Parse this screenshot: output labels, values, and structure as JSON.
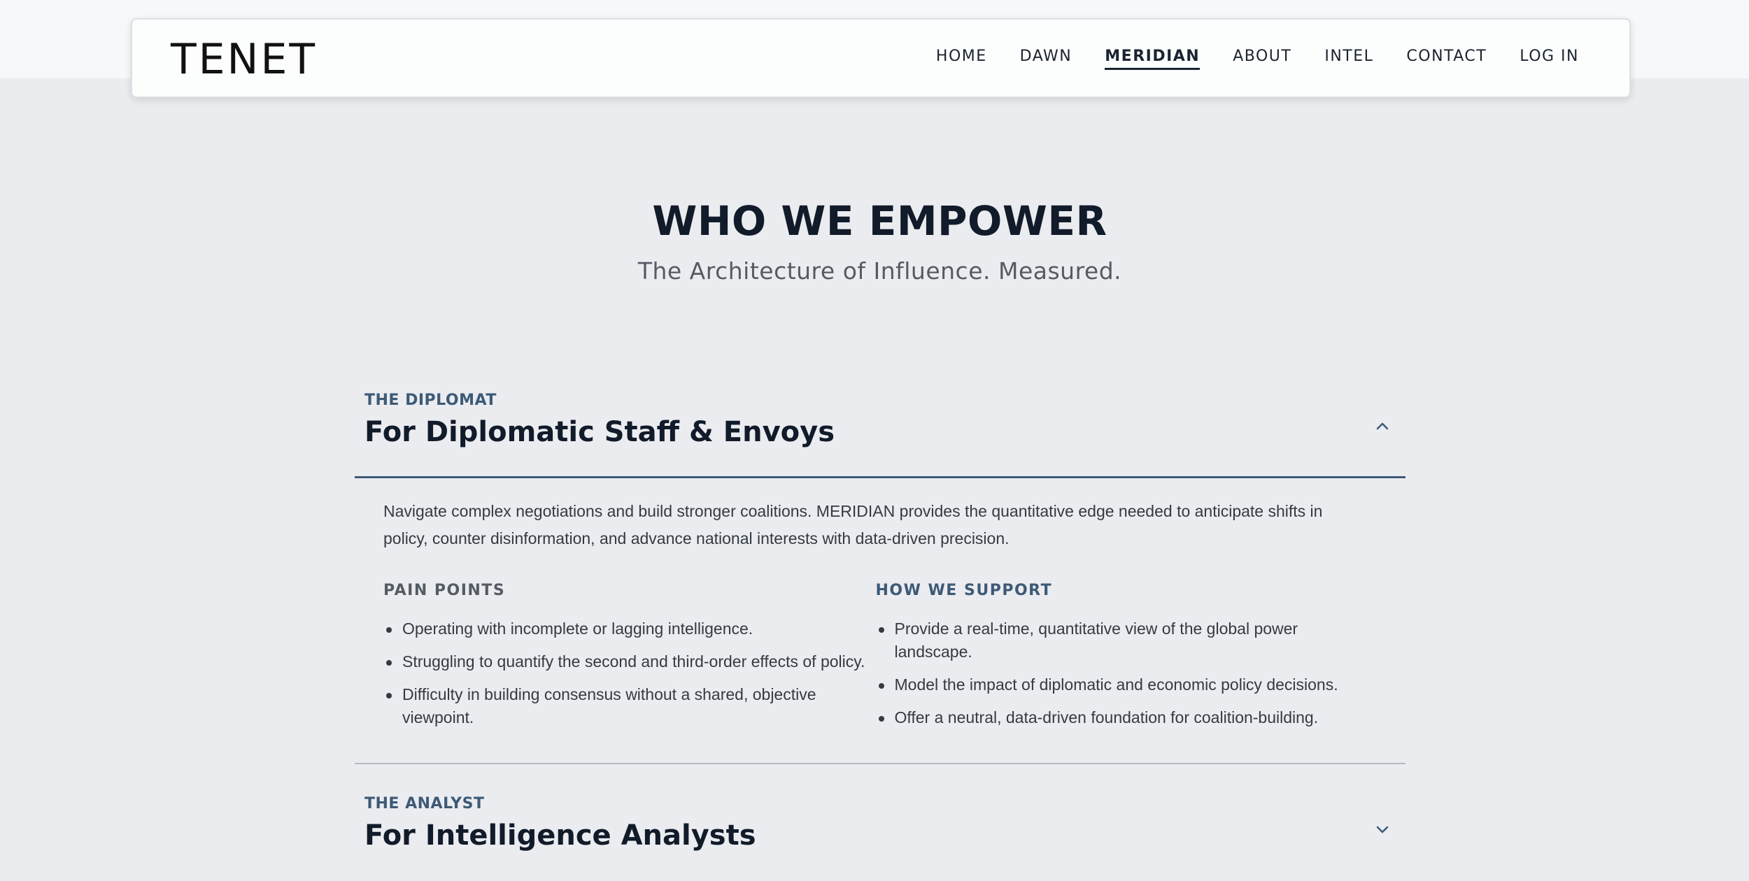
{
  "brand": {
    "logo": "TENET"
  },
  "nav": {
    "items": [
      {
        "label": "HOME",
        "active": false
      },
      {
        "label": "DAWN",
        "active": false
      },
      {
        "label": "MERIDIAN",
        "active": true
      },
      {
        "label": "ABOUT",
        "active": false
      },
      {
        "label": "INTEL",
        "active": false
      },
      {
        "label": "CONTACT",
        "active": false
      },
      {
        "label": "LOG IN",
        "active": false
      }
    ]
  },
  "hero": {
    "title": "WHO WE EMPOWER",
    "subtitle": "The Architecture of Influence. Measured."
  },
  "accordion": {
    "items": [
      {
        "eyebrow": "THE DIPLOMAT",
        "title": "For Diplomatic Staff & Envoys",
        "expanded": true,
        "description": "Navigate complex negotiations and build stronger coalitions. MERIDIAN provides the quantitative edge needed to anticipate shifts in policy, counter disinformation, and advance national interests with data-driven precision.",
        "pain_points": {
          "heading": "PAIN POINTS",
          "items": [
            "Operating with incomplete or lagging intelligence.",
            "Struggling to quantify the second and third-order effects of policy.",
            "Difficulty in building consensus without a shared, objective viewpoint."
          ]
        },
        "support": {
          "heading": "HOW WE SUPPORT",
          "items": [
            "Provide a real-time, quantitative view of the global power landscape.",
            "Model the impact of diplomatic and economic policy decisions.",
            "Offer a neutral, data-driven foundation for coalition-building."
          ]
        }
      },
      {
        "eyebrow": "THE ANALYST",
        "title": "For Intelligence Analysts",
        "expanded": false
      }
    ]
  },
  "icons": {
    "expanded": "chevron-up-icon",
    "collapsed": "chevron-down-icon"
  },
  "colors": {
    "accent": "#3d5a76",
    "text": "#111b29",
    "background": "#ebecf0"
  }
}
